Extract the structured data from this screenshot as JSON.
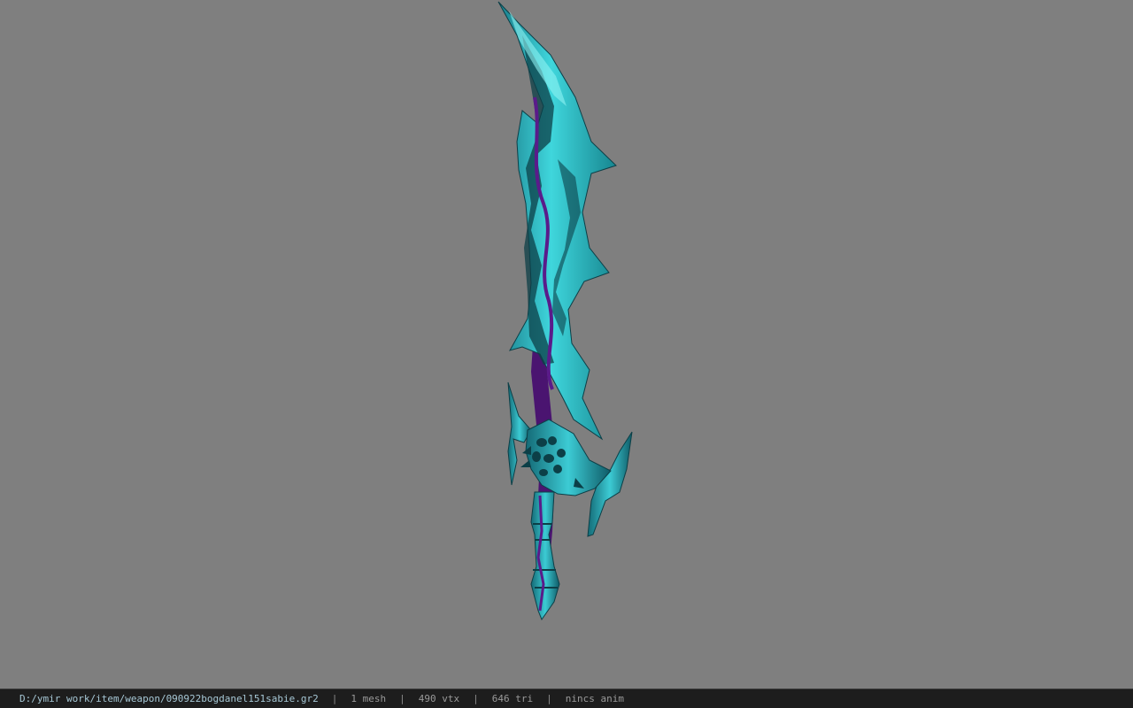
{
  "viewer": {
    "background_color": "#7f7f7f",
    "model": {
      "name": "sword-model",
      "colors": {
        "primary": "#33c9d2",
        "highlight": "#7ff0f0",
        "shadow": "#0c3f47",
        "accent": "#4a1470"
      }
    }
  },
  "status_bar": {
    "file_path": "D:/ymir work/item/weapon/090922bogdanel151sabie.gr2",
    "separator": "|",
    "mesh_count": "1 mesh",
    "vertex_count": "490 vtx",
    "triangle_count": "646 tri",
    "animation": "nincs anim"
  }
}
